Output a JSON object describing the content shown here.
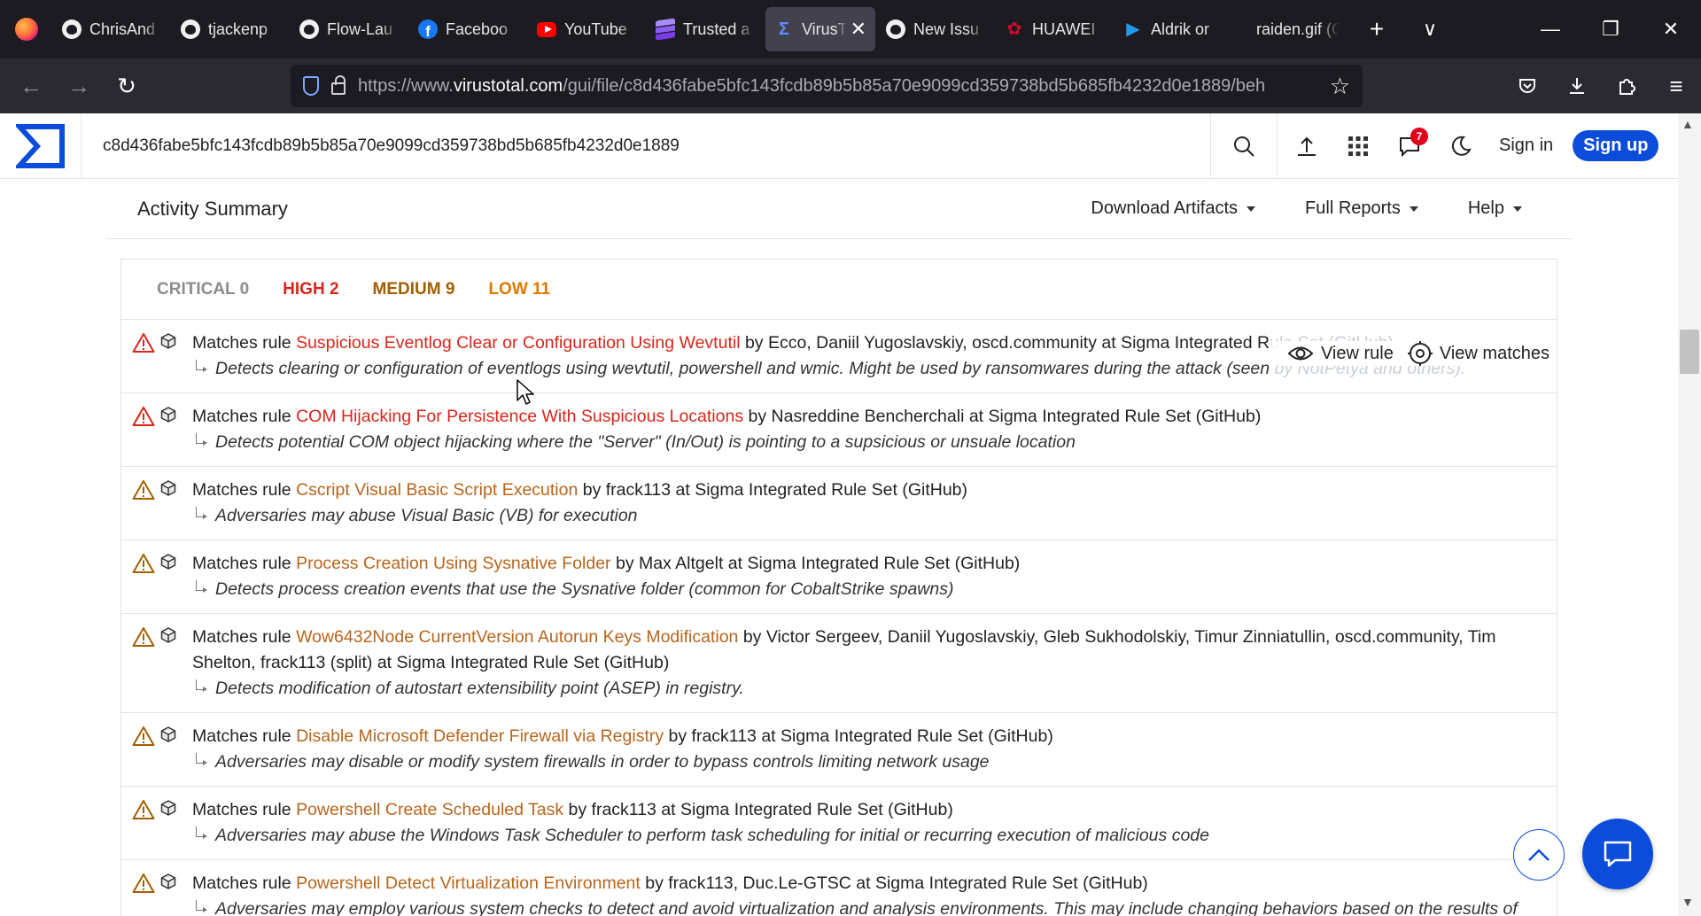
{
  "browser": {
    "tabs": [
      {
        "label": "ChrisAnd",
        "icon": "github-icon"
      },
      {
        "label": "tjackenp",
        "icon": "github-icon"
      },
      {
        "label": "Flow-Lau",
        "icon": "github-icon"
      },
      {
        "label": "Faceboo",
        "icon": "facebook-icon"
      },
      {
        "label": "YouTube",
        "icon": "youtube-icon"
      },
      {
        "label": "Trusted a",
        "icon": "stack-icon"
      },
      {
        "label": "VirusT",
        "icon": "virustotal-icon",
        "active": true
      },
      {
        "label": "New Issu",
        "icon": "github-icon"
      },
      {
        "label": "HUAWEI",
        "icon": "huawei-icon"
      },
      {
        "label": "Aldrik or",
        "icon": "twitter-icon"
      },
      {
        "label": "raiden.gif (G",
        "icon": "none"
      }
    ],
    "url_prefix": "https://www.",
    "url_host": "virustotal.com",
    "url_rest": "/gui/file/c8d436fabe5bfc143fcdb89b5b85a70e9099cd359738bd5b685fb4232d0e1889/beh"
  },
  "vt": {
    "search_value": "c8d436fabe5bfc143fcdb89b5b85a70e9099cd359738bd5b685fb4232d0e1889",
    "notification_count": "7",
    "sign_in": "Sign in",
    "sign_up": "Sign up",
    "accent": "#0b4dda"
  },
  "summary": {
    "title": "Activity Summary",
    "menus": [
      "Download Artifacts",
      "Full Reports",
      "Help"
    ]
  },
  "severity": {
    "critical": "CRITICAL 0",
    "high": "HIGH 2",
    "medium": "MEDIUM 9",
    "low": "LOW 11"
  },
  "rule_actions": {
    "view_rule": "View rule",
    "view_matches": "View matches"
  },
  "rules": [
    {
      "prefix": "Matches rule ",
      "name": "Suspicious Eventlog Clear or Configuration Using Wevtutil",
      "severity": "high",
      "author": " by Ecco, Daniil Yugoslavskiy, oscd.community at Sigma Integrated R",
      "author_fade": "ule Set (GitHub)",
      "desc": "Detects clearing or configuration of eventlogs using wevtutil, powershell and wmic. Might be used by ransomwares during the attack (seen",
      "desc_fade": " by NotPetya and others)."
    },
    {
      "prefix": "Matches rule ",
      "name": "COM Hijacking For Persistence With Suspicious Locations",
      "severity": "high",
      "author": " by Nasreddine Bencherchali at Sigma Integrated Rule Set (GitHub)",
      "desc": "Detects potential COM object hijacking where the \"Server\" (In/Out) is pointing to a supsicious or unsuale location"
    },
    {
      "prefix": "Matches rule ",
      "name": "Cscript Visual Basic Script Execution",
      "severity": "medium",
      "author": " by frack113 at Sigma Integrated Rule Set (GitHub)",
      "desc": "Adversaries may abuse Visual Basic (VB) for execution"
    },
    {
      "prefix": "Matches rule ",
      "name": "Process Creation Using Sysnative Folder",
      "severity": "medium",
      "author": " by Max Altgelt at Sigma Integrated Rule Set (GitHub)",
      "desc": "Detects process creation events that use the Sysnative folder (common for CobaltStrike spawns)"
    },
    {
      "prefix": "Matches rule ",
      "name": "Wow6432Node CurrentVersion Autorun Keys Modification",
      "severity": "medium",
      "author": " by Victor Sergeev, Daniil Yugoslavskiy, Gleb Sukhodolskiy, Timur Zinniatullin, oscd.community, Tim Shelton, frack113 (split) at Sigma Integrated Rule Set (GitHub)",
      "desc": "Detects modification of autostart extensibility point (ASEP) in registry."
    },
    {
      "prefix": "Matches rule ",
      "name": "Disable Microsoft Defender Firewall via Registry",
      "severity": "medium",
      "author": " by frack113 at Sigma Integrated Rule Set (GitHub)",
      "desc": "Adversaries may disable or modify system firewalls in order to bypass controls limiting network usage"
    },
    {
      "prefix": "Matches rule ",
      "name": "Powershell Create Scheduled Task",
      "severity": "medium",
      "author": " by frack113 at Sigma Integrated Rule Set (GitHub)",
      "desc": "Adversaries may abuse the Windows Task Scheduler to perform task scheduling for initial or recurring execution of malicious code"
    },
    {
      "prefix": "Matches rule ",
      "name": "Powershell Detect Virtualization Environment",
      "severity": "medium",
      "author": " by frack113, Duc.Le-GTSC at Sigma Integrated Rule Set (GitHub)",
      "desc": "Adversaries may employ various system checks to detect and avoid virtualization and analysis environments. This may include changing behaviors based on the results of checks for the presence of artifacts indicative of a virtual machine environment (VME) or sandbox"
    }
  ]
}
